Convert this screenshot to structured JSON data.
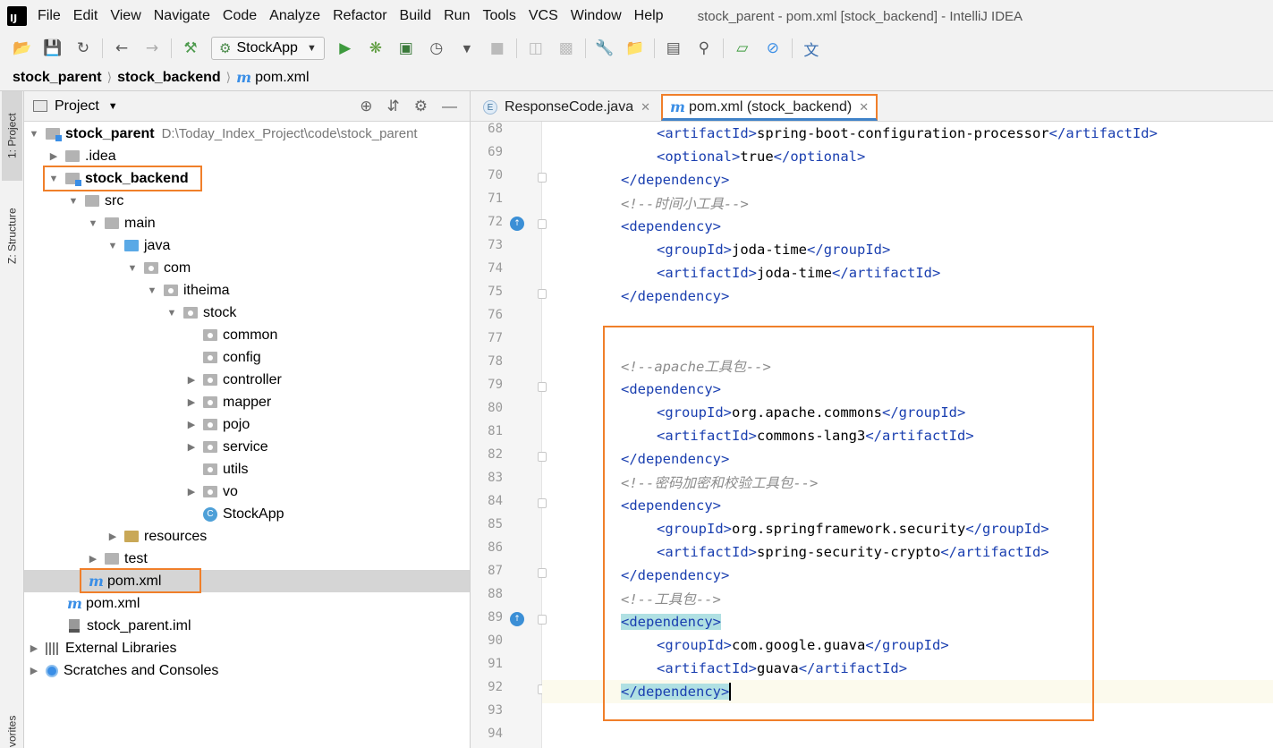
{
  "menubar": {
    "logo": "IJ",
    "items": [
      "File",
      "Edit",
      "View",
      "Navigate",
      "Code",
      "Analyze",
      "Refactor",
      "Build",
      "Run",
      "Tools",
      "VCS",
      "Window",
      "Help"
    ],
    "window_title": "stock_parent - pom.xml [stock_backend] - IntelliJ IDEA"
  },
  "toolbar": {
    "run_config": "StockApp",
    "icons": [
      "open-folder-icon",
      "save-icon",
      "sync-icon",
      "back-icon",
      "forward-icon",
      "build-hammer-icon",
      "run-icon",
      "debug-icon",
      "coverage-icon",
      "profile-icon",
      "stop-icon",
      "attach-icon",
      "settings-wrench-icon",
      "project-structure-icon",
      "terminal-icon",
      "search-icon",
      "statistics-icon",
      "disable-icon",
      "translate-icon"
    ]
  },
  "breadcrumb": {
    "items": [
      "stock_parent",
      "stock_backend",
      "pom.xml"
    ]
  },
  "left_strip": {
    "project_tab": "1: Project",
    "structure_tab": "Z: Structure",
    "favorites_tab": "vorites"
  },
  "project_panel": {
    "title": "Project",
    "tree": [
      {
        "label": "stock_parent",
        "path": "D:\\Today_Index_Project\\code\\stock_parent"
      },
      {
        "label": ".idea"
      },
      {
        "label": "stock_backend"
      },
      {
        "label": "src"
      },
      {
        "label": "main"
      },
      {
        "label": "java"
      },
      {
        "label": "com"
      },
      {
        "label": "itheima"
      },
      {
        "label": "stock"
      },
      {
        "label": "common"
      },
      {
        "label": "config"
      },
      {
        "label": "controller"
      },
      {
        "label": "mapper"
      },
      {
        "label": "pojo"
      },
      {
        "label": "service"
      },
      {
        "label": "utils"
      },
      {
        "label": "vo"
      },
      {
        "label": "StockApp"
      },
      {
        "label": "resources"
      },
      {
        "label": "test"
      },
      {
        "label": "pom.xml"
      },
      {
        "label": "pom.xml"
      },
      {
        "label": "stock_parent.iml"
      },
      {
        "label": "External Libraries"
      },
      {
        "label": "Scratches and Consoles"
      }
    ]
  },
  "editor": {
    "tabs": [
      {
        "label": "ResponseCode.java",
        "icon": "E",
        "active": false
      },
      {
        "label": "pom.xml (stock_backend)",
        "icon": "m",
        "active": true
      }
    ],
    "line_numbers": [
      "68",
      "69",
      "70",
      "71",
      "72",
      "73",
      "74",
      "75",
      "76",
      "77",
      "78",
      "79",
      "80",
      "81",
      "82",
      "83",
      "84",
      "85",
      "86",
      "87",
      "88",
      "89",
      "90",
      "91",
      "92",
      "93",
      "94"
    ],
    "code": {
      "l68": {
        "open": "<",
        "tag": "artifactId",
        "gt": ">",
        "text": "spring-boot-configuration-processor",
        "close_open": "</",
        "close_tag": "artifactId",
        "close_gt": ">"
      },
      "l69": {
        "open": "<",
        "tag": "optional",
        "gt": ">",
        "text": "true",
        "close_open": "</",
        "close_tag": "optional",
        "close_gt": ">"
      },
      "l70": "</dependency>",
      "l71": "<!--时间小工具-->",
      "l72": "<dependency>",
      "l73": {
        "tag": "groupId",
        "text": "joda-time"
      },
      "l74": {
        "tag": "artifactId",
        "text": "joda-time"
      },
      "l75": "</dependency>",
      "l78": "<!--apache工具包-->",
      "l79": "<dependency>",
      "l80": {
        "tag": "groupId",
        "text": "org.apache.commons"
      },
      "l81": {
        "tag": "artifactId",
        "text": "commons-lang3"
      },
      "l82": "</dependency>",
      "l83": "<!--密码加密和校验工具包-->",
      "l84": "<dependency>",
      "l85": {
        "tag": "groupId",
        "text": "org.springframework.security"
      },
      "l86": {
        "tag": "artifactId",
        "text": "spring-security-crypto"
      },
      "l87": "</dependency>",
      "l88": "<!--工具包-->",
      "l89": "<dependency>",
      "l90": {
        "tag": "groupId",
        "text": "com.google.guava"
      },
      "l91": {
        "tag": "artifactId",
        "text": "guava"
      },
      "l92": "</dependency>"
    }
  },
  "colors": {
    "highlight_box": "#f07f2a",
    "xml_tag": "#1a3fb0",
    "comment": "#8c8c8c",
    "brace_match": "#b0e0e3",
    "current_line": "#fcfaed"
  }
}
